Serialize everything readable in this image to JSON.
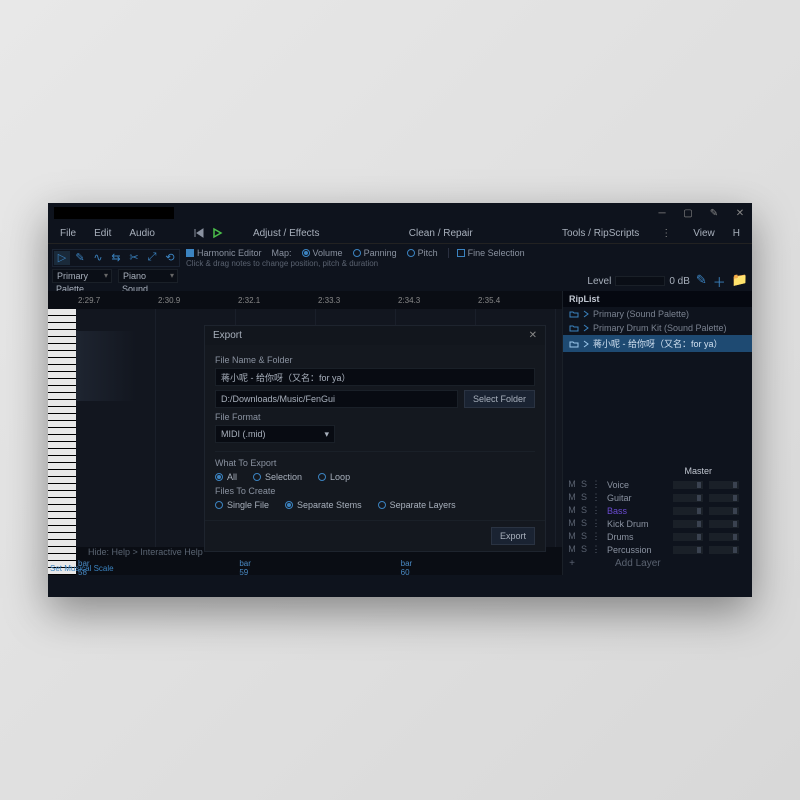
{
  "menubar": {
    "file": "File",
    "edit": "Edit",
    "audio": "Audio",
    "adjust": "Adjust / Effects",
    "clean": "Clean / Repair",
    "tools": "Tools / RipScripts",
    "view": "View",
    "help": "H"
  },
  "toolbar": {
    "harmonic": "Harmonic Editor",
    "map": "Map:",
    "volume": "Volume",
    "panning": "Panning",
    "pitch": "Pitch",
    "fine": "Fine Selection",
    "hint": "Click & drag notes to change position, pitch & duration"
  },
  "dropdowns": {
    "primary": "Primary",
    "palette": "Palette",
    "piano": "Piano",
    "sound": "Sound",
    "level": "Level",
    "level_val": "0 dB"
  },
  "timeline": [
    "2:29.7",
    "2:30.9",
    "2:32.1",
    "2:33.3",
    "2:34.3",
    "2:35.4"
  ],
  "bars": [
    "bar 58",
    "bar 59",
    "bar 60"
  ],
  "hint_text": "Hide: Help > Interactive Help",
  "scale_link": "Set Musical Scale",
  "riplist": {
    "title": "RipList",
    "items": [
      {
        "label": "Primary (Sound Palette)",
        "selected": false
      },
      {
        "label": "Primary Drum Kit (Sound Palette)",
        "selected": false
      },
      {
        "label": "蒋小呢 - 给你呀（又名：for ya）",
        "selected": true
      }
    ]
  },
  "mixer": {
    "master": "Master",
    "layers": [
      {
        "name": "Voice",
        "accent": false
      },
      {
        "name": "Guitar",
        "accent": false
      },
      {
        "name": "Bass",
        "accent": true
      },
      {
        "name": "Kick Drum",
        "accent": false
      },
      {
        "name": "Drums",
        "accent": false
      },
      {
        "name": "Percussion",
        "accent": false
      }
    ],
    "add": "Add Layer",
    "m": "M",
    "s": "S",
    "more": "⋮"
  },
  "export": {
    "title": "Export",
    "filename_label": "File Name & Folder",
    "filename": "蒋小呢 - 给你呀（又名：for ya）",
    "folder": "D:/Downloads/Music/FenGui",
    "select_folder": "Select Folder",
    "format_label": "File Format",
    "format": "MIDI (.mid)",
    "what_label": "What To Export",
    "what_opts": [
      "All",
      "Selection",
      "Loop"
    ],
    "files_label": "Files To Create",
    "files_opts": [
      "Single File",
      "Separate Stems",
      "Separate Layers"
    ],
    "export_btn": "Export"
  }
}
